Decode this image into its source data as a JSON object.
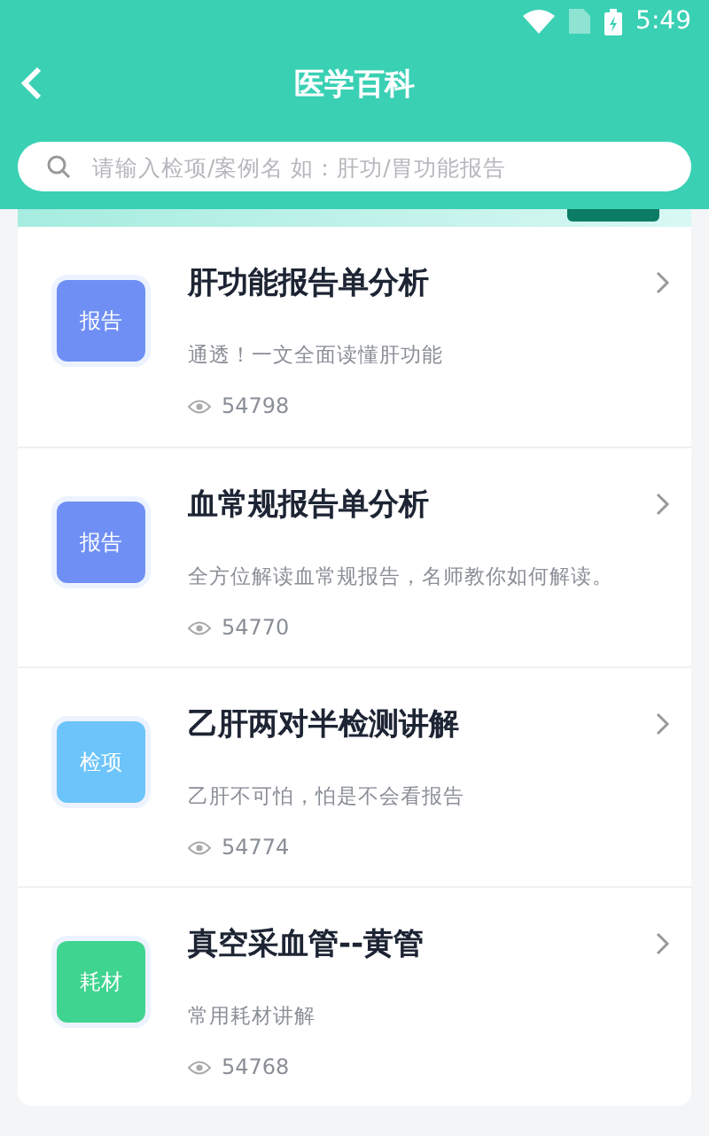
{
  "status_bar": {
    "time": "5:49"
  },
  "header": {
    "title": "医学百科"
  },
  "search": {
    "placeholder": "请输入检项/案例名 如：肝功/胃功能报告"
  },
  "articles": [
    {
      "tag": "报告",
      "color": "#6f8ff5",
      "title": "肝功能报告单分析",
      "summary": "通透！一文全面读懂肝功能",
      "views": "54798"
    },
    {
      "tag": "报告",
      "color": "#6f8ff5",
      "title": "血常规报告单分析",
      "summary": "全方位解读血常规报告，名师教你如何解读。",
      "views": "54770"
    },
    {
      "tag": "检项",
      "color": "#6cc4fa",
      "title": "乙肝两对半检测讲解",
      "summary": "乙肝不可怕，怕是不会看报告",
      "views": "54774"
    },
    {
      "tag": "耗材",
      "color": "#3fd48f",
      "title": "真空采血管--黄管",
      "summary": "常用耗材讲解",
      "views": "54768"
    }
  ]
}
